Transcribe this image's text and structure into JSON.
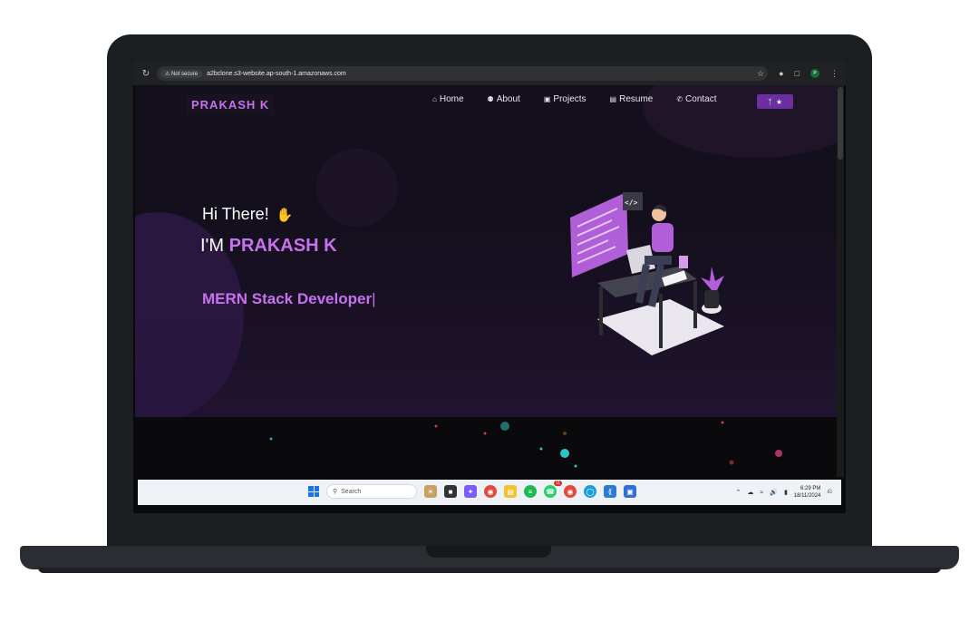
{
  "browser": {
    "security_label": "Not secure",
    "url": "a2bclone.s3-website.ap-south-1.amazonaws.com",
    "profile_initial": "P"
  },
  "site": {
    "brand": "PRAKASH K",
    "nav": [
      {
        "label": "Home",
        "icon": "home-icon"
      },
      {
        "label": "About",
        "icon": "user-icon"
      },
      {
        "label": "Projects",
        "icon": "projects-icon"
      },
      {
        "label": "Resume",
        "icon": "document-icon"
      },
      {
        "label": "Contact",
        "icon": "phone-icon"
      }
    ],
    "github_button_icon": "fork-star-icon",
    "accent_color": "#c770f0"
  },
  "hero": {
    "greeting": "Hi There!",
    "im_prefix": "I'M",
    "name": "PRAKASH K",
    "role": "MERN Stack Developer"
  },
  "taskbar": {
    "search_placeholder": "Search",
    "whatsapp_badge": "11",
    "time": "6:29 PM",
    "date": "18/11/2024"
  }
}
